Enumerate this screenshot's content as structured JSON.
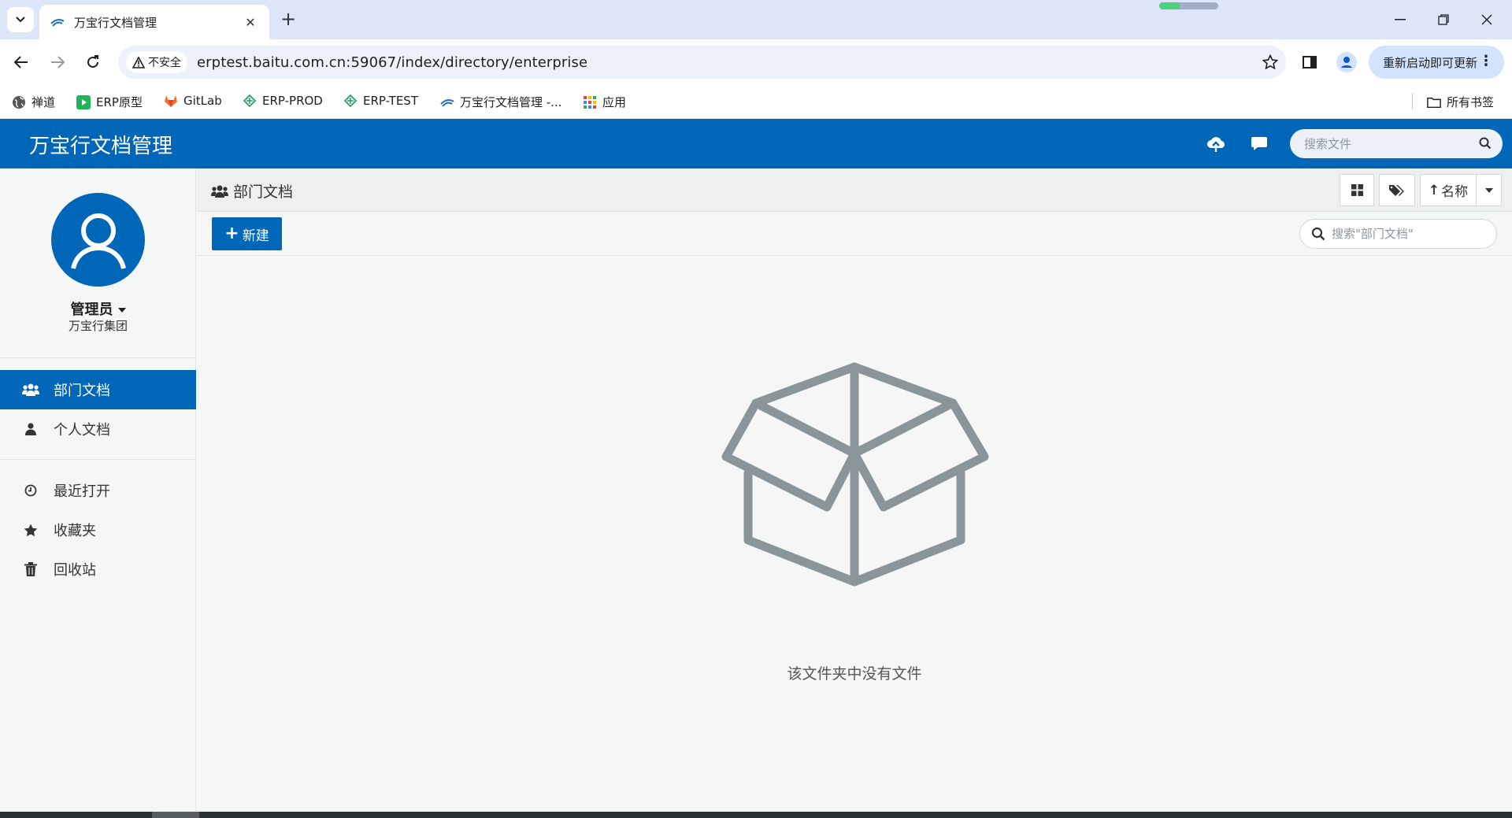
{
  "browser": {
    "tab_title": "万宝行文档管理",
    "security_label": "不安全",
    "url": "erptest.baitu.com.cn:59067/index/directory/enterprise",
    "update_button": "重新启动即可更新",
    "bookmarks": [
      {
        "label": "禅道",
        "icon": "globe-icon"
      },
      {
        "label": "ERP原型",
        "icon": "play-icon"
      },
      {
        "label": "GitLab",
        "icon": "gitlab-icon"
      },
      {
        "label": "ERP-PROD",
        "icon": "erp-icon"
      },
      {
        "label": "ERP-TEST",
        "icon": "erp-icon"
      },
      {
        "label": "万宝行文档管理 -...",
        "icon": "wanbao-icon"
      },
      {
        "label": "应用",
        "icon": "apps-grid-icon"
      }
    ],
    "all_bookmarks": "所有书签"
  },
  "app": {
    "title": "万宝行文档管理",
    "search_placeholder": "搜索文件",
    "accent_color": "#0066b8"
  },
  "user": {
    "name": "管理员",
    "org": "万宝行集团"
  },
  "sidebar": {
    "items": [
      {
        "label": "部门文档",
        "icon": "users-icon",
        "active": true
      },
      {
        "label": "个人文档",
        "icon": "user-icon",
        "active": false
      },
      {
        "label": "最近打开",
        "icon": "clock-icon",
        "active": false
      },
      {
        "label": "收藏夹",
        "icon": "star-icon",
        "active": false
      },
      {
        "label": "回收站",
        "icon": "trash-icon",
        "active": false
      }
    ]
  },
  "main": {
    "breadcrumb": "部门文档",
    "sort_label": "名称",
    "new_button": "新建",
    "dir_search_placeholder": "搜索\"部门文档\"",
    "empty_message": "该文件夹中没有文件"
  }
}
